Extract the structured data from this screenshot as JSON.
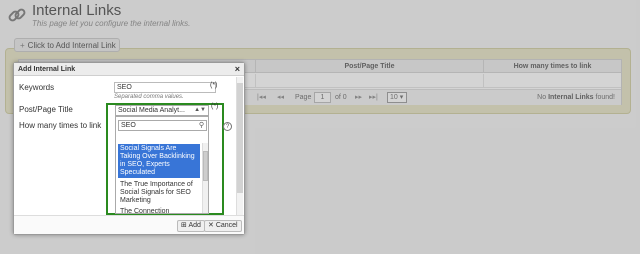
{
  "header": {
    "title": "Internal Links",
    "subtitle": "This page let you configure the internal links.",
    "icon": "chain-link-icon"
  },
  "toolbar": {
    "add_label": "Click to Add Internal Link"
  },
  "grid": {
    "columns": [
      "Post/Page Title",
      "How many times to link"
    ],
    "pager": {
      "first": "|◂◂",
      "prev": "◂◂",
      "page_label": "Page",
      "page_value": "1",
      "of_label": "of 0",
      "next": "▸▸",
      "last": "▸▸|",
      "page_size": "10",
      "info_prefix": "No",
      "info_bold": "Internal Links",
      "info_suffix": "found!"
    }
  },
  "dialog": {
    "title": "Add Internal Link",
    "close": "×",
    "keywords_label": "Keywords",
    "keywords_value": "SEO",
    "required_mark": "(*)",
    "keywords_hint": "Separated comma values.",
    "post_label": "Post/Page Title",
    "post_selected": "Social Media Analyt...",
    "times_label": "How many times to link",
    "search_value": "SEO",
    "options": [
      "Social Signals Are Taking Over Backlinking in SEO, Experts Speculated",
      "The True Importance of Social Signals for SEO Marketing",
      "The Connection"
    ],
    "help": "?",
    "add_button": "Add",
    "cancel_button": "Cancel"
  },
  "colors": {
    "highlight": "#2a8a1f",
    "selected_option": "#3875d7",
    "panel_bg": "#e6e4c3"
  }
}
